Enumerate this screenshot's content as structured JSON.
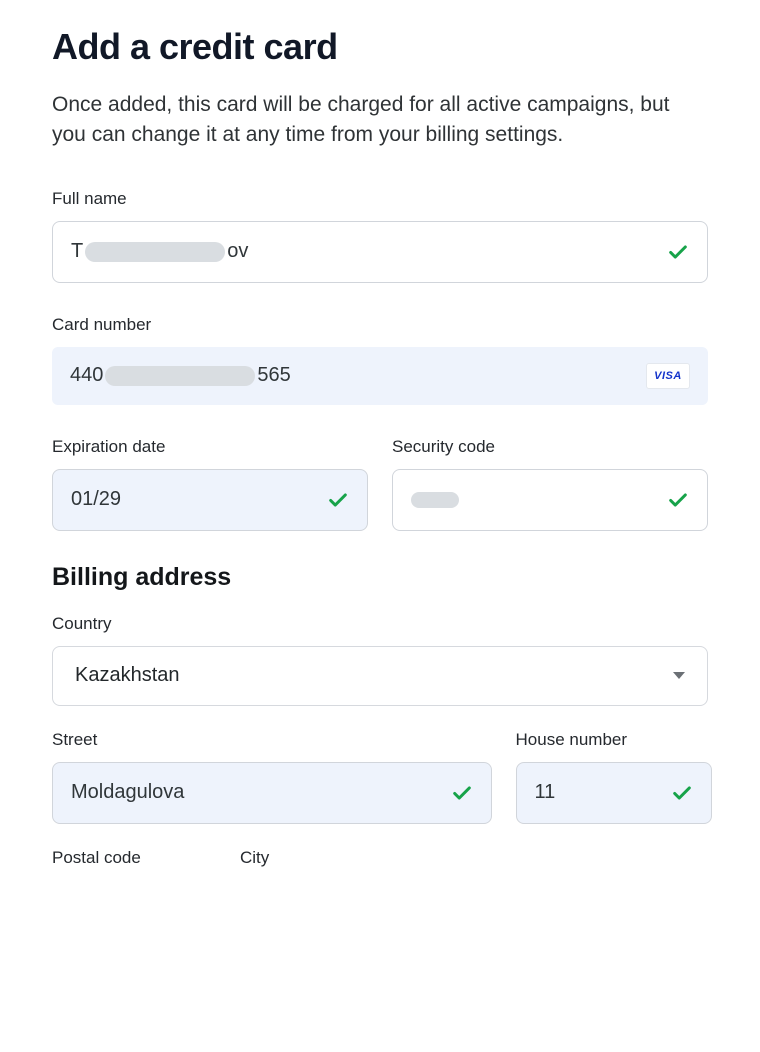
{
  "header": {
    "title": "Add a credit card",
    "description": "Once added, this card will be charged for all active campaigns, but you can change it at any time from your billing settings."
  },
  "form": {
    "full_name": {
      "label": "Full name",
      "value_prefix": "T",
      "value_suffix": "ov",
      "valid": true
    },
    "card_number": {
      "label": "Card number",
      "value_prefix": "440",
      "value_suffix": "565",
      "brand": "VISA"
    },
    "expiration": {
      "label": "Expiration date",
      "value": "01/29",
      "valid": true
    },
    "security": {
      "label": "Security code",
      "valid": true
    }
  },
  "billing": {
    "section_title": "Billing address",
    "country": {
      "label": "Country",
      "value": "Kazakhstan"
    },
    "street": {
      "label": "Street",
      "value": "Moldagulova",
      "valid": true
    },
    "house": {
      "label": "House number",
      "value": "11",
      "valid": true
    },
    "postal": {
      "label": "Postal code"
    },
    "city": {
      "label": "City"
    }
  }
}
